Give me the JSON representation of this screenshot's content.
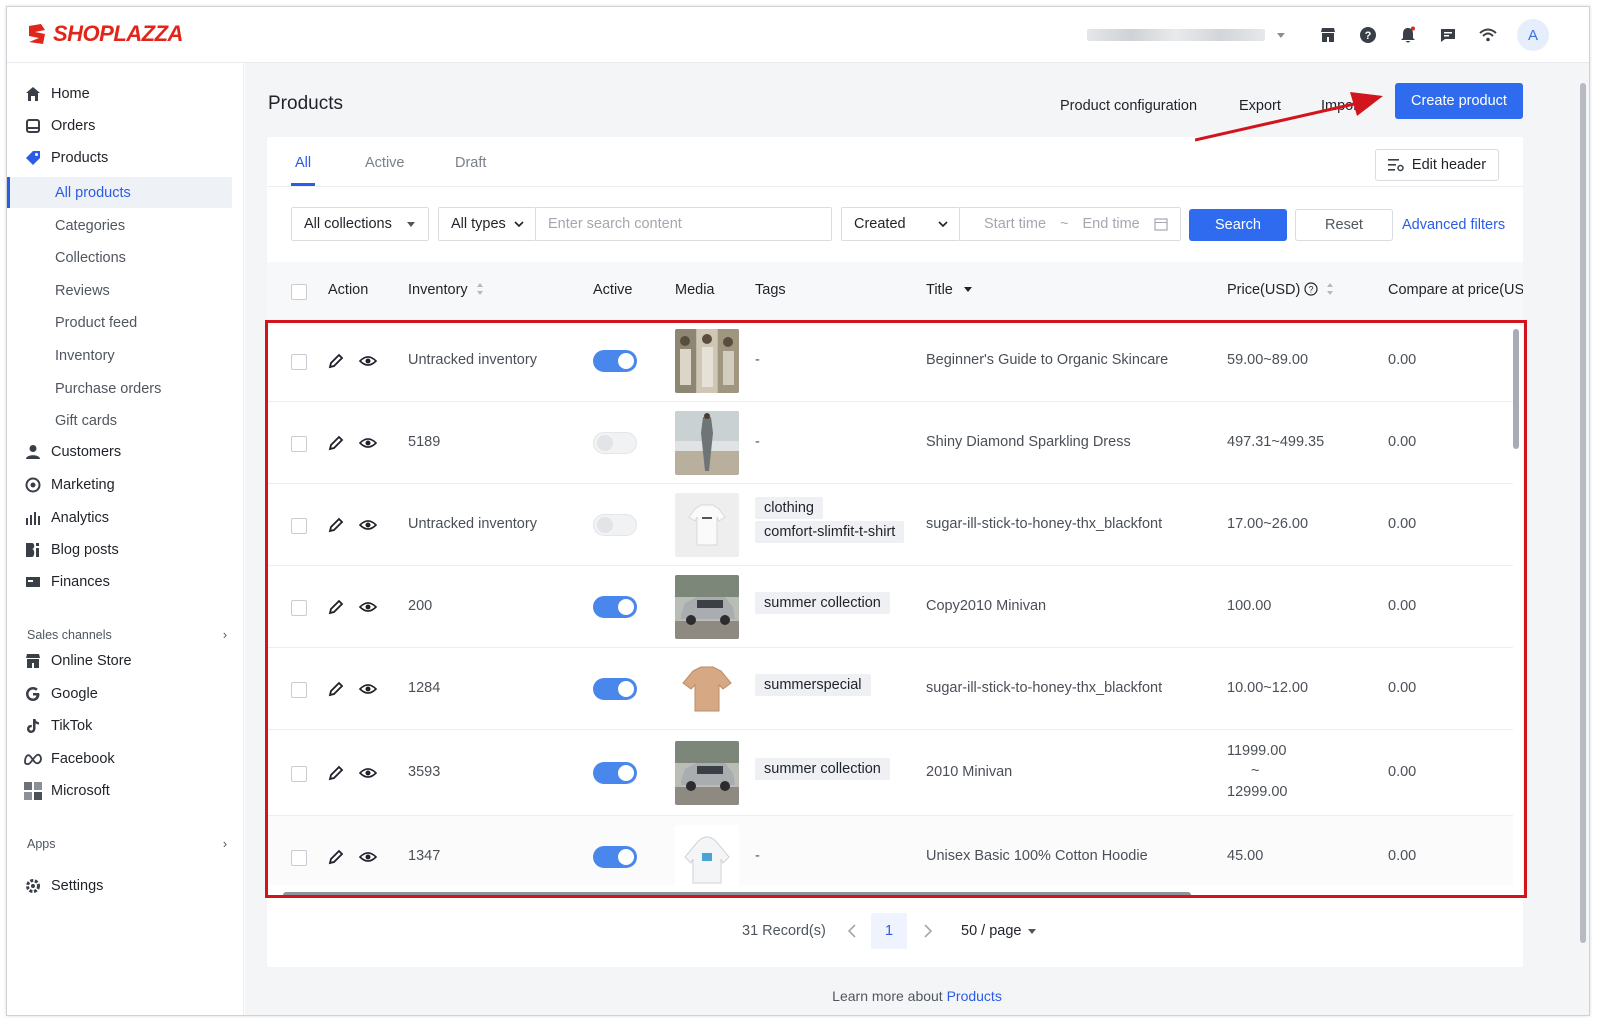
{
  "app": {
    "brand": "SHOPLAZZA",
    "store_name": "",
    "avatar_letter": "A"
  },
  "topbar": {
    "icons": [
      "store-icon",
      "help-icon",
      "bell-icon",
      "message-icon",
      "wifi-icon"
    ]
  },
  "sidebar": {
    "items": [
      {
        "label": "Home",
        "icon": "home-icon"
      },
      {
        "label": "Orders",
        "icon": "orders-icon"
      },
      {
        "label": "Products",
        "icon": "tag-icon"
      },
      {
        "label": "Customers",
        "icon": "user-icon"
      },
      {
        "label": "Marketing",
        "icon": "marketing-icon"
      },
      {
        "label": "Analytics",
        "icon": "analytics-icon"
      },
      {
        "label": "Blog posts",
        "icon": "blog-icon"
      },
      {
        "label": "Finances",
        "icon": "finances-icon"
      }
    ],
    "product_sub": [
      "All products",
      "Categories",
      "Collections",
      "Reviews",
      "Product feed",
      "Inventory",
      "Purchase orders",
      "Gift cards"
    ],
    "sales_channels_label": "Sales channels",
    "channels": [
      {
        "label": "Online Store",
        "icon": "store-icon"
      },
      {
        "label": "Google",
        "icon": "google-icon"
      },
      {
        "label": "TikTok",
        "icon": "tiktok-icon"
      },
      {
        "label": "Facebook",
        "icon": "meta-icon"
      },
      {
        "label": "Microsoft",
        "icon": "microsoft-icon"
      }
    ],
    "apps_label": "Apps",
    "settings_label": "Settings"
  },
  "header": {
    "title": "Products",
    "product_configuration": "Product configuration",
    "export": "Export",
    "import": "Import",
    "create_product": "Create product"
  },
  "tabs": {
    "all": "All",
    "active": "Active",
    "draft": "Draft",
    "edit_header": "Edit header"
  },
  "filters": {
    "collections": "All collections",
    "types": "All types",
    "search_placeholder": "Enter search content",
    "sort": "Created",
    "start_time": "Start time",
    "tilde": "~",
    "end_time": "End time",
    "search": "Search",
    "reset": "Reset",
    "advanced": "Advanced filters"
  },
  "table": {
    "columns": {
      "action": "Action",
      "inventory": "Inventory",
      "active": "Active",
      "media": "Media",
      "tags": "Tags",
      "title": "Title",
      "price": "Price(USD)",
      "compare": "Compare at price(USD"
    },
    "rows": [
      {
        "inventory": "Untracked inventory",
        "active": true,
        "tags": [],
        "title": "Beginner's Guide to Organic Skincare",
        "price": "59.00~89.00",
        "compare": "0.00",
        "media": "women-clothing"
      },
      {
        "inventory": "5189",
        "active": false,
        "tags": [],
        "title": "Shiny Diamond Sparkling Dress",
        "price": "497.31~499.35",
        "compare": "0.00",
        "media": "dress"
      },
      {
        "inventory": "Untracked inventory",
        "active": false,
        "tags": [
          "clothing",
          "comfort-slimfit-t-shirt"
        ],
        "title": "sugar-ill-stick-to-honey-thx_blackfont",
        "price": "17.00~26.00",
        "compare": "0.00",
        "media": "white-tshirt"
      },
      {
        "inventory": "200",
        "active": true,
        "tags": [
          "summer collection"
        ],
        "title": "Copy2010 Minivan",
        "price": "100.00",
        "compare": "0.00",
        "media": "minivan"
      },
      {
        "inventory": "1284",
        "active": true,
        "tags": [
          "summerspecial"
        ],
        "title": "sugar-ill-stick-to-honey-thx_blackfont",
        "price": "10.00~12.00",
        "compare": "0.00",
        "media": "tan-tshirt"
      },
      {
        "inventory": "3593",
        "active": true,
        "tags": [
          "summer collection"
        ],
        "title": "2010 Minivan",
        "price_lines": [
          "11999.00",
          "~",
          "12999.00"
        ],
        "compare": "0.00",
        "media": "minivan"
      },
      {
        "inventory": "1347",
        "active": true,
        "tags": [],
        "title": "Unisex Basic 100% Cotton Hoodie",
        "price": "45.00",
        "compare": "0.00",
        "media": "hoodie"
      }
    ],
    "empty_tag": "-"
  },
  "pagination": {
    "records": "31 Record(s)",
    "current": "1",
    "per_page": "50 / page"
  },
  "footer": {
    "learn_more": "Learn more about ",
    "link": "Products"
  },
  "colors": {
    "brand": "#e1251b",
    "primary": "#2e6bef",
    "highlight": "#d2141c"
  }
}
